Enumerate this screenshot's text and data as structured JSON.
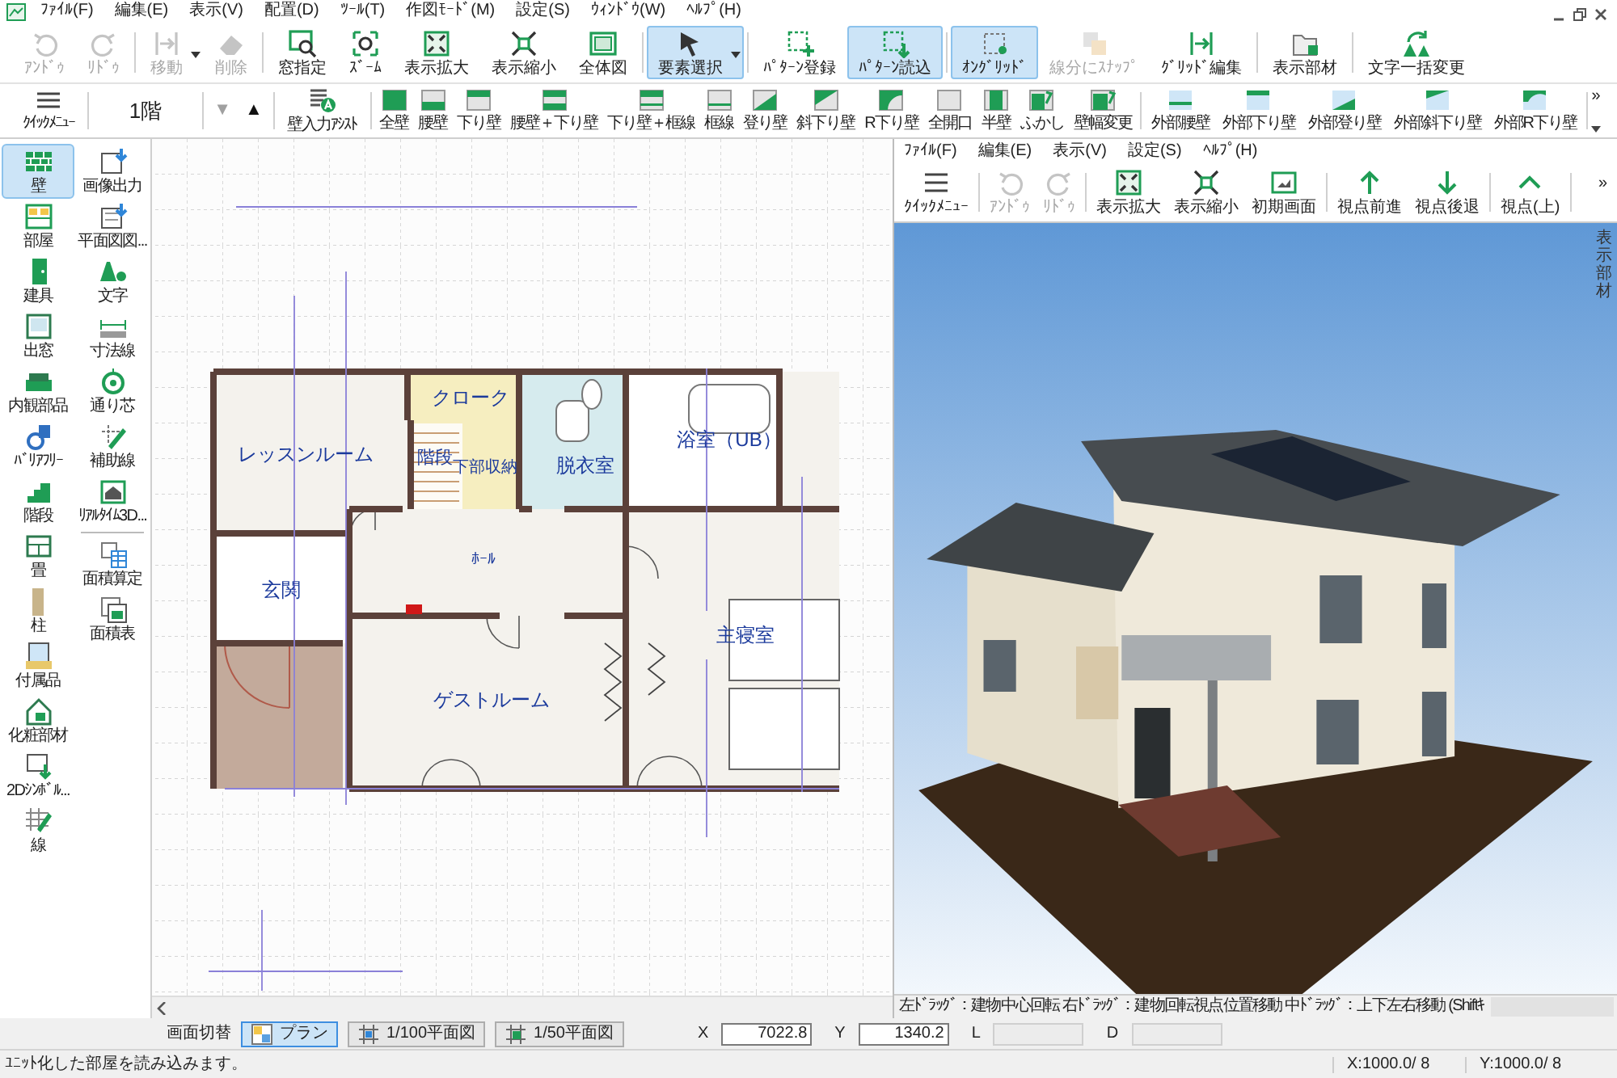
{
  "menu_bar": [
    "ﾌｧｲﾙ(F)",
    "編集(E)",
    "表示(V)",
    "配置(D)",
    "ﾂｰﾙ(T)",
    "作図ﾓｰﾄﾞ(M)",
    "設定(S)",
    "ｳｨﾝﾄﾞｳ(W)",
    "ﾍﾙﾌﾟ(H)"
  ],
  "main_toolbar": [
    {
      "label": "ｱﾝﾄﾞｩ",
      "disabled": true,
      "selected": false,
      "dropdown": false
    },
    {
      "label": "ﾘﾄﾞｩ",
      "disabled": true,
      "selected": false,
      "dropdown": false
    },
    {
      "label": "移動",
      "disabled": true,
      "selected": false,
      "dropdown": true
    },
    {
      "label": "削除",
      "disabled": true,
      "selected": false,
      "dropdown": false
    },
    {
      "label": "窓指定",
      "disabled": false,
      "selected": false,
      "dropdown": false
    },
    {
      "label": "ｽﾞｰﾑ",
      "disabled": false,
      "selected": false,
      "dropdown": false
    },
    {
      "label": "表示拡大",
      "disabled": false,
      "selected": false,
      "dropdown": false
    },
    {
      "label": "表示縮小",
      "disabled": false,
      "selected": false,
      "dropdown": false
    },
    {
      "label": "全体図",
      "disabled": false,
      "selected": false,
      "dropdown": false
    },
    {
      "label": "要素選択",
      "disabled": false,
      "selected": true,
      "dropdown": true
    },
    {
      "label": "ﾊﾟﾀｰﾝ登録",
      "disabled": false,
      "selected": false,
      "dropdown": false
    },
    {
      "label": "ﾊﾟﾀｰﾝ読込",
      "disabled": false,
      "selected": true,
      "dropdown": false
    },
    {
      "label": "ｵﾝｸﾞﾘｯﾄﾞ",
      "disabled": false,
      "selected": true,
      "dropdown": false
    },
    {
      "label": "線分にｽﾅｯﾌﾟ",
      "disabled": true,
      "selected": false,
      "dropdown": false
    },
    {
      "label": "ｸﾞﾘｯﾄﾞ編集",
      "disabled": false,
      "selected": false,
      "dropdown": false
    },
    {
      "label": "表示部材",
      "disabled": false,
      "selected": false,
      "dropdown": false
    },
    {
      "label": "文字一括変更",
      "disabled": false,
      "selected": false,
      "dropdown": false
    }
  ],
  "wall_toolbar": {
    "quick_menu": "ｸｲｯｸﾒﾆｭｰ",
    "floor": "1階",
    "floor_down": {
      "label": "▼",
      "disabled": true
    },
    "floor_up": {
      "label": "▲",
      "disabled": false
    },
    "assist": "壁入力ｱｼｽﾄ",
    "walls": [
      "全壁",
      "腰壁",
      "下り壁",
      "腰壁＋下り壁",
      "下り壁＋框線",
      "框線",
      "登り壁",
      "斜下り壁",
      "R下り壁",
      "全開口",
      "半壁",
      "ふかし",
      "壁幅変更"
    ],
    "exterior_walls": [
      "外部腰壁",
      "外部下り壁",
      "外部登り壁",
      "外部斜下り壁",
      "外部R下り壁"
    ],
    "more": "»"
  },
  "sidebar": {
    "column_1": [
      {
        "label": "壁",
        "selected": true
      },
      {
        "label": "部屋",
        "selected": false
      },
      {
        "label": "建具",
        "selected": false
      },
      {
        "label": "出窓",
        "selected": false
      },
      {
        "label": "内観部品",
        "selected": false
      },
      {
        "label": "ﾊﾞﾘｱﾌﾘｰ",
        "selected": false
      },
      {
        "label": "階段",
        "selected": false
      },
      {
        "label": "畳",
        "selected": false
      },
      {
        "label": "柱",
        "selected": false
      },
      {
        "label": "付属品",
        "selected": false
      },
      {
        "label": "化粧部材",
        "selected": false
      },
      {
        "label": "2Dｼﾝﾎﾞﾙ...",
        "selected": false
      },
      {
        "label": "線",
        "selected": false
      }
    ],
    "column_2": [
      [
        {
          "label": "画像出力",
          "selected": false
        },
        {
          "label": "平面図図...",
          "selected": false
        },
        {
          "label": "文字",
          "selected": false
        },
        {
          "label": "寸法線",
          "selected": false
        },
        {
          "label": "通り芯",
          "selected": false
        },
        {
          "label": "補助線",
          "selected": false
        },
        {
          "label": "ﾘｱﾙﾀｲﾑ3D...",
          "selected": false
        }
      ],
      [
        {
          "label": "面積算定",
          "selected": false
        },
        {
          "label": "面積表",
          "selected": false
        }
      ]
    ]
  },
  "plan": {
    "rooms": [
      "クローク",
      "レッスンルーム",
      "階段",
      "下部収納",
      "脱衣室",
      "浴室（UB）",
      "ﾎｰﾙ",
      "玄関",
      "主寝室",
      "ゲストルーム"
    ]
  },
  "viewer": {
    "menu_bar": [
      "ﾌｧｲﾙ(F)",
      "編集(E)",
      "表示(V)",
      "設定(S)",
      "ﾍﾙﾌﾟ(H)"
    ],
    "toolbar": [
      {
        "label": "ｸｲｯｸﾒﾆｭｰ",
        "disabled": false
      },
      {
        "label": "ｱﾝﾄﾞｩ",
        "disabled": true
      },
      {
        "label": "ﾘﾄﾞｩ",
        "disabled": true
      },
      {
        "label": "表示拡大",
        "disabled": false
      },
      {
        "label": "表示縮小",
        "disabled": false
      },
      {
        "label": "初期画面",
        "disabled": false
      },
      {
        "label": "視点前進",
        "disabled": false
      },
      {
        "label": "視点後退",
        "disabled": false
      },
      {
        "label": "視点(上)",
        "disabled": false
      }
    ],
    "more": "»",
    "side_tab": "表示部材",
    "hint": "左ﾄﾞﾗｯｸﾞ：建物中心回転 右ﾄﾞﾗｯｸﾞ：建物回転視点位置移動 中ﾄﾞﾗｯｸﾞ：上下左右移動 (Shiftｷ"
  },
  "bottom_bar": {
    "label": "画面切替",
    "views": [
      {
        "label": "プラン",
        "selected": true
      },
      {
        "label": "1/100平面図",
        "selected": false
      },
      {
        "label": "1/50平面図",
        "selected": false
      }
    ],
    "fields": [
      {
        "label": "X",
        "value": "7022.8",
        "disabled": false
      },
      {
        "label": "Y",
        "value": "1340.2",
        "disabled": false
      },
      {
        "label": "L",
        "disabled": true
      },
      {
        "label": "D",
        "disabled": true
      }
    ]
  },
  "status_bar": {
    "message": "ﾕﾆｯﾄ化した部屋を読み込みます。",
    "x": "X:1000.0/ 8",
    "y": "Y:1000.0/ 8"
  }
}
